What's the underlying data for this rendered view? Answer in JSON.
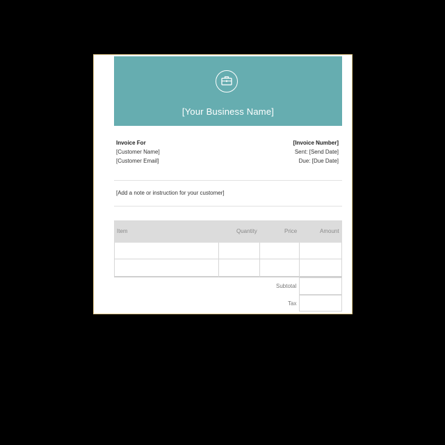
{
  "header": {
    "business_name": "[Your Business Name]",
    "logo_icon": "briefcase-icon",
    "color": "#66adb0"
  },
  "bill_to": {
    "heading": "Invoice For",
    "customer_name": "[Customer Name]",
    "customer_email": "[Customer Email]"
  },
  "invoice_info": {
    "number": "[Invoice Number]",
    "sent": "Sent: [Send Date]",
    "due": "Due: [Due Date]"
  },
  "note": "[Add a note or instruction for your customer]",
  "table": {
    "columns": [
      "Item",
      "Quantity",
      "Price",
      "Amount"
    ]
  },
  "totals": {
    "subtotal_label": "Subtotal",
    "tax_label": "Tax"
  }
}
